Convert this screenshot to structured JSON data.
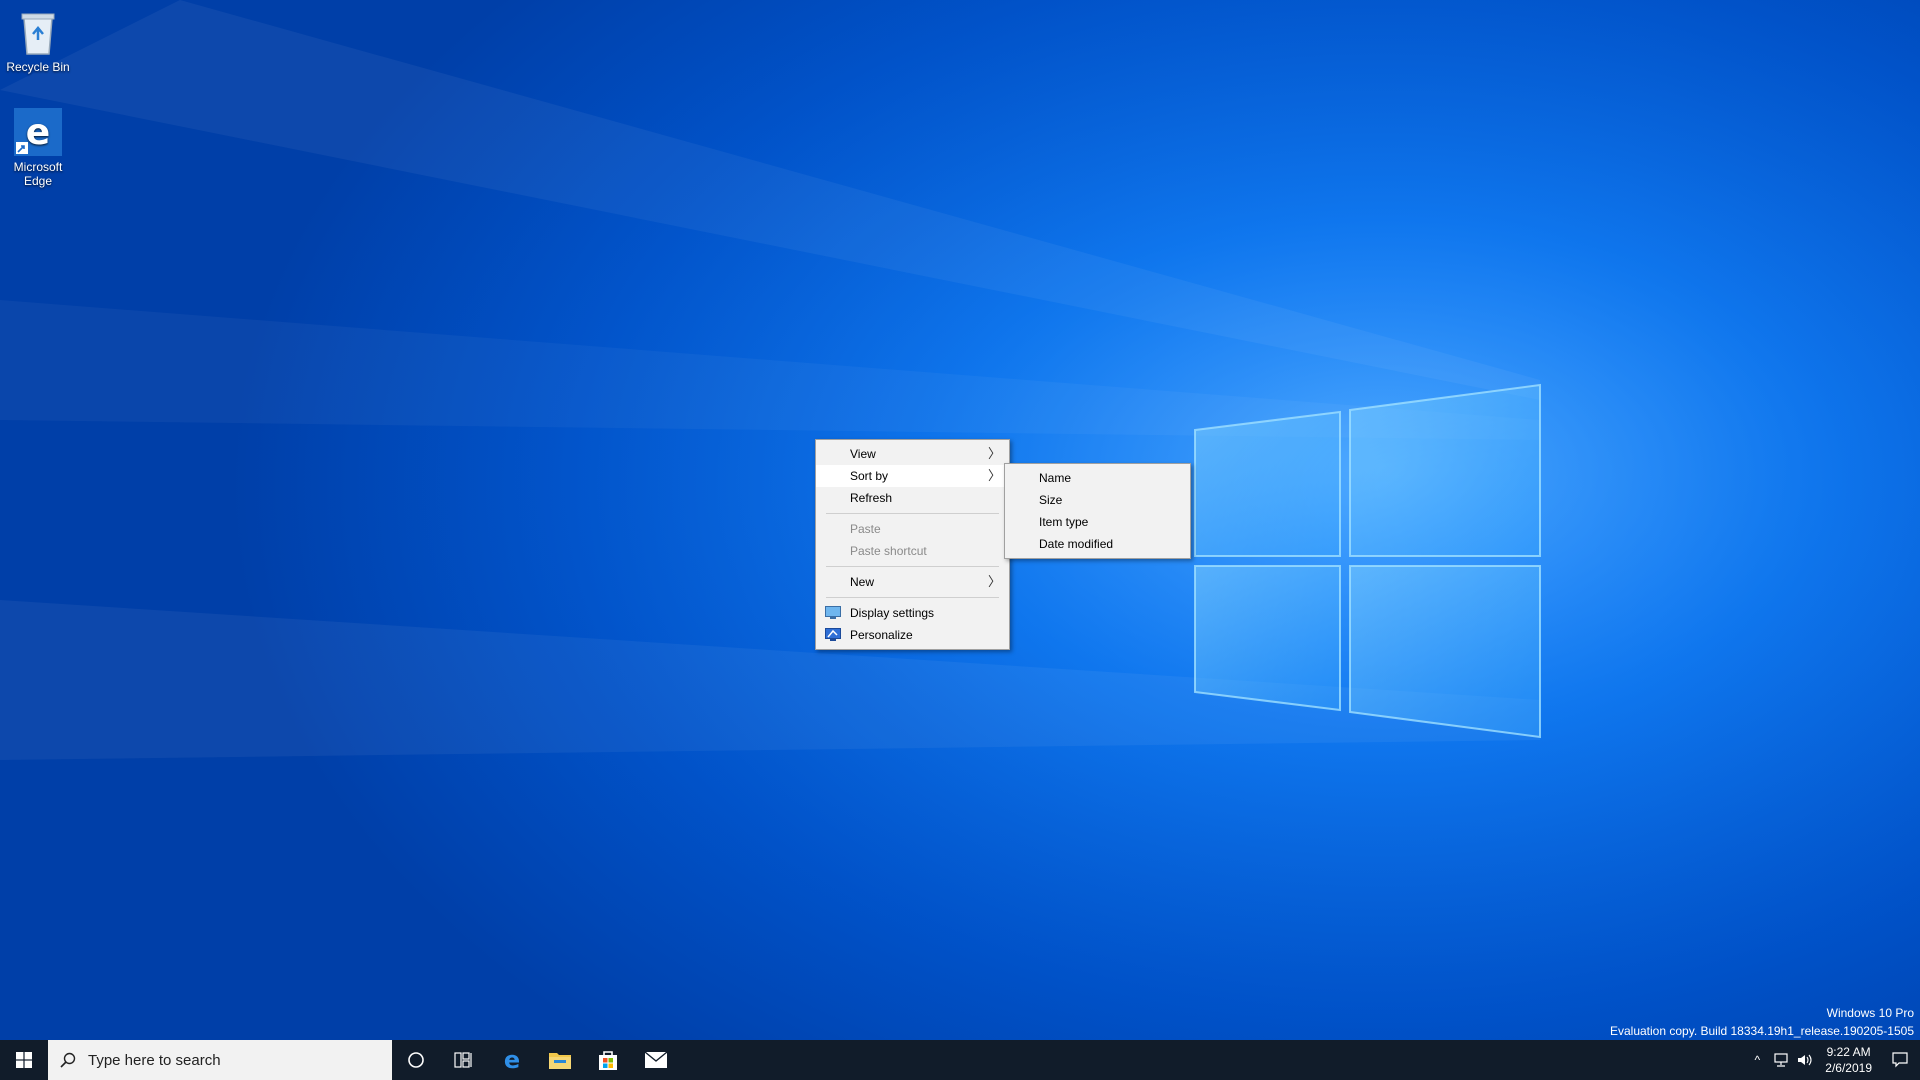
{
  "desktop": {
    "icons": [
      {
        "label": "Recycle Bin",
        "icon": "recycle-bin-icon"
      },
      {
        "label": "Microsoft\nEdge",
        "icon": "edge-icon"
      }
    ]
  },
  "context_menu": {
    "items": [
      {
        "label": "View",
        "has_submenu": true
      },
      {
        "label": "Sort by",
        "has_submenu": true,
        "active": true
      },
      {
        "label": "Refresh"
      },
      {
        "label": "Paste",
        "disabled": true
      },
      {
        "label": "Paste shortcut",
        "disabled": true
      },
      {
        "label": "New",
        "has_submenu": true
      },
      {
        "label": "Display settings",
        "icon": "display-settings-icon"
      },
      {
        "label": "Personalize",
        "icon": "personalize-icon"
      }
    ],
    "arrow": "〉"
  },
  "submenu": {
    "items": [
      "Name",
      "Size",
      "Item type",
      "Date modified"
    ]
  },
  "watermark": {
    "line1": "Windows 10 Pro",
    "line2": "Evaluation copy. Build 18334.19h1_release.190205-1505"
  },
  "taskbar": {
    "search_placeholder": "Type here to search",
    "pinned": [
      "cortana-icon",
      "task-view-icon",
      "edge-icon",
      "file-explorer-icon",
      "store-icon",
      "mail-icon"
    ],
    "clock_time": "9:22 AM",
    "clock_date": "2/6/2019"
  },
  "colors": {
    "taskbar": "#111c2a",
    "menu_bg": "#f2f2f2",
    "accent": "#0078d7"
  }
}
